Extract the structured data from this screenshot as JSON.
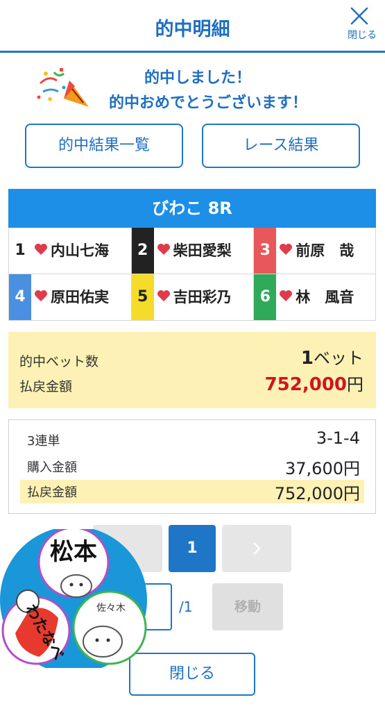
{
  "header": {
    "title": "的中明細",
    "close_label": "閉じる"
  },
  "hit": {
    "line1": "的中しました！",
    "line2": "的中おめでとうございます！"
  },
  "buttons": {
    "hit_list": "的中結果一覧",
    "race_result": "レース結果"
  },
  "race": {
    "title": "びわこ 8R",
    "racers": [
      {
        "num": "1",
        "name": "内山七海",
        "bg": "#ffffff",
        "fg": "#222222"
      },
      {
        "num": "2",
        "name": "柴田愛梨",
        "bg": "#222222",
        "fg": "#ffffff"
      },
      {
        "num": "3",
        "name": "前原　哉",
        "bg": "#e8585b",
        "fg": "#ffffff"
      },
      {
        "num": "4",
        "name": "原田佑実",
        "bg": "#4a8fe0",
        "fg": "#ffffff"
      },
      {
        "num": "5",
        "name": "吉田彩乃",
        "bg": "#f5dc2a",
        "fg": "#222222"
      },
      {
        "num": "6",
        "name": "林　風音",
        "bg": "#2faa5a",
        "fg": "#ffffff"
      }
    ]
  },
  "summary": {
    "bets_label": "的中ベット数",
    "bets_value": "1",
    "bets_unit": "ベット",
    "payout_label": "払戻金額",
    "payout_value": "752,000",
    "payout_unit": "円"
  },
  "detail": {
    "type_label": "3連単",
    "type_value": "3-1-4",
    "purchase_label": "購入金額",
    "purchase_value": "37,600円",
    "payout_label": "払戻金額",
    "payout_value": "752,000円"
  },
  "pager": {
    "current": "1",
    "next_icon": "chevron-right-icon"
  },
  "jump": {
    "total": "/1",
    "button": "移動"
  },
  "close_button": "閉じる",
  "sticker": {
    "word_top": "松本",
    "word_right": "佐々木",
    "word_left": "わたなべ"
  },
  "colors": {
    "accent": "#1f75c6",
    "race_header": "#1d8fe6",
    "highlight": "#fdf1b5",
    "payout_red": "#d1151f"
  }
}
